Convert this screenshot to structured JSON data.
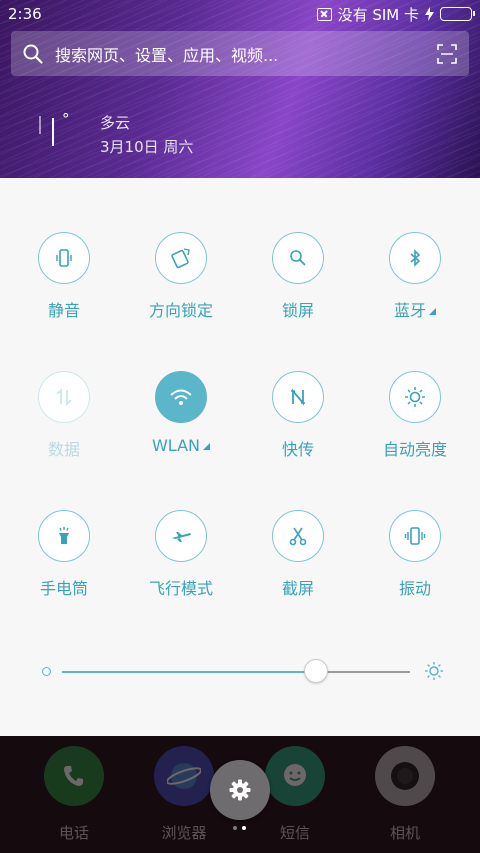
{
  "status_bar": {
    "time": "2:36",
    "carrier": "没有 SIM 卡",
    "battery_level": 1.0
  },
  "search": {
    "placeholder": "搜索网页、设置、应用、视频..."
  },
  "weather": {
    "temperature": "°",
    "condition": "多云",
    "date": "3月10日 周六"
  },
  "quick_settings": [
    {
      "label": "静音",
      "icon": "silent-icon",
      "state": "off"
    },
    {
      "label": "方向锁定",
      "icon": "rotation-lock-icon",
      "state": "off"
    },
    {
      "label": "锁屏",
      "icon": "lock-screen-icon",
      "state": "off"
    },
    {
      "label": "蓝牙",
      "icon": "bluetooth-icon",
      "state": "off",
      "has_menu": true
    },
    {
      "label": "数据",
      "icon": "mobile-data-icon",
      "state": "disabled"
    },
    {
      "label": "WLAN",
      "icon": "wifi-icon",
      "state": "on",
      "has_menu": true
    },
    {
      "label": "快传",
      "icon": "quick-transfer-icon",
      "state": "off"
    },
    {
      "label": "自动亮度",
      "icon": "auto-brightness-icon",
      "state": "off"
    },
    {
      "label": "手电筒",
      "icon": "flashlight-icon",
      "state": "off"
    },
    {
      "label": "飞行模式",
      "icon": "airplane-icon",
      "state": "off"
    },
    {
      "label": "截屏",
      "icon": "screenshot-icon",
      "state": "off"
    },
    {
      "label": "振动",
      "icon": "vibrate-icon",
      "state": "off"
    }
  ],
  "brightness": {
    "level": 0.73
  },
  "dock": [
    {
      "label": "电话",
      "icon": "phone-icon",
      "color": "#1f8a3a"
    },
    {
      "label": "浏览器",
      "icon": "browser-icon",
      "color": "#3a4ab8"
    },
    {
      "label": "短信",
      "icon": "messages-icon",
      "color": "#1fa07a"
    },
    {
      "label": "相机",
      "icon": "camera-icon",
      "color": "#b0b0b0"
    }
  ],
  "colors": {
    "accent": "#5ab6c8",
    "label": "#3aa3b8",
    "panel_bg": "#f7f7f7"
  }
}
